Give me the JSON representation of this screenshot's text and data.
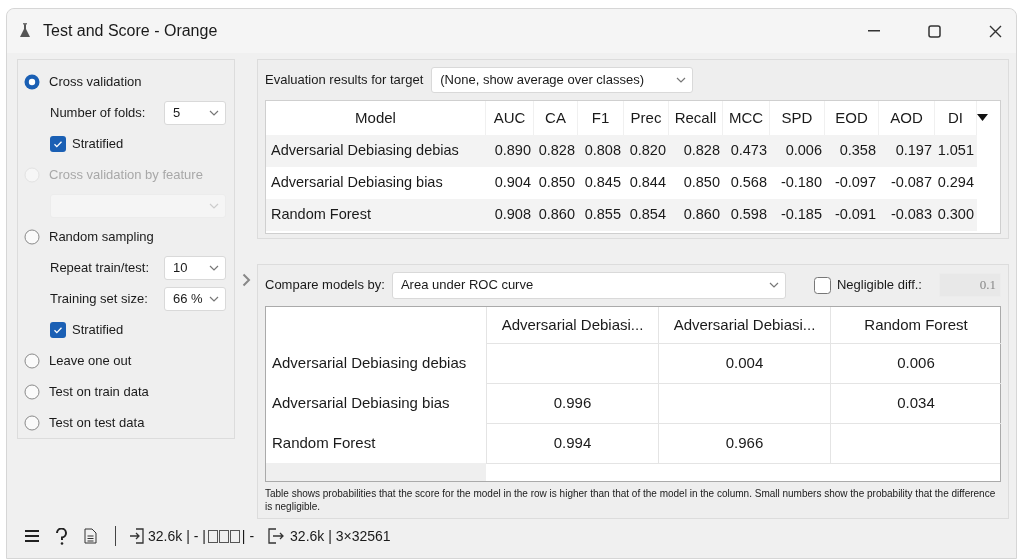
{
  "window": {
    "title": "Test and Score - Orange"
  },
  "sampling": [
    {
      "label": "Cross validation",
      "selected": true,
      "disabled": false,
      "settings": [
        {
          "kind": "select",
          "label": "Number of folds:",
          "value": "5"
        },
        {
          "kind": "checkbox",
          "label": "Stratified",
          "checked": true
        }
      ]
    },
    {
      "label": "Cross validation by feature",
      "selected": false,
      "disabled": true,
      "settings": [
        {
          "kind": "select"
        }
      ]
    },
    {
      "label": "Random sampling",
      "selected": false,
      "disabled": false,
      "settings": [
        {
          "kind": "select",
          "label": "Repeat train/test:",
          "value": "10"
        },
        {
          "kind": "select",
          "label": "Training set size:",
          "value": "66 %"
        },
        {
          "kind": "checkbox",
          "label": "Stratified",
          "checked": true
        }
      ]
    },
    {
      "label": "Leave one out",
      "selected": false,
      "disabled": false
    },
    {
      "label": "Test on train data",
      "selected": false,
      "disabled": false
    },
    {
      "label": "Test on test data",
      "selected": false,
      "disabled": false
    }
  ],
  "evaluation": {
    "target_label": "Evaluation results for target",
    "target_value": "(None, show average over classes)",
    "columns": [
      "Model",
      "AUC",
      "CA",
      "F1",
      "Prec",
      "Recall",
      "MCC",
      "SPD",
      "EOD",
      "AOD",
      "DI"
    ],
    "rows": [
      [
        "Adversarial Debiasing debias",
        "0.890",
        "0.828",
        "0.808",
        "0.820",
        "0.828",
        "0.473",
        "0.006",
        "0.358",
        "0.197",
        "1.051"
      ],
      [
        "Adversarial Debiasing bias",
        "0.904",
        "0.850",
        "0.845",
        "0.844",
        "0.850",
        "0.568",
        "-0.180",
        "-0.097",
        "-0.087",
        "0.294"
      ],
      [
        "Random Forest",
        "0.908",
        "0.860",
        "0.855",
        "0.854",
        "0.860",
        "0.598",
        "-0.185",
        "-0.091",
        "-0.083",
        "0.300"
      ]
    ]
  },
  "comparison": {
    "compare_label": "Compare models by:",
    "compare_value": "Area under ROC curve",
    "negligible_label": "Negligible diff.:",
    "negligible_checked": false,
    "negligible_value": "0.1",
    "columns": [
      "Adversarial Debiasi...",
      "Adversarial Debiasi...",
      "Random Forest"
    ],
    "rows": [
      {
        "label": "Adversarial Debiasing debias",
        "cells": [
          null,
          "0.004",
          "0.006"
        ]
      },
      {
        "label": "Adversarial Debiasing bias",
        "cells": [
          "0.996",
          null,
          "0.034"
        ]
      },
      {
        "label": "Random Forest",
        "cells": [
          "0.994",
          "0.966",
          null
        ]
      }
    ],
    "note": "Table shows probabilities that the score for the model in the row is higher than that of the model in the column. Small numbers show the probability that the difference is negligible."
  },
  "status_bar": {
    "input": "32.6k | - |",
    "input_tail": "| -",
    "output": "32.6k | 3×32561"
  }
}
